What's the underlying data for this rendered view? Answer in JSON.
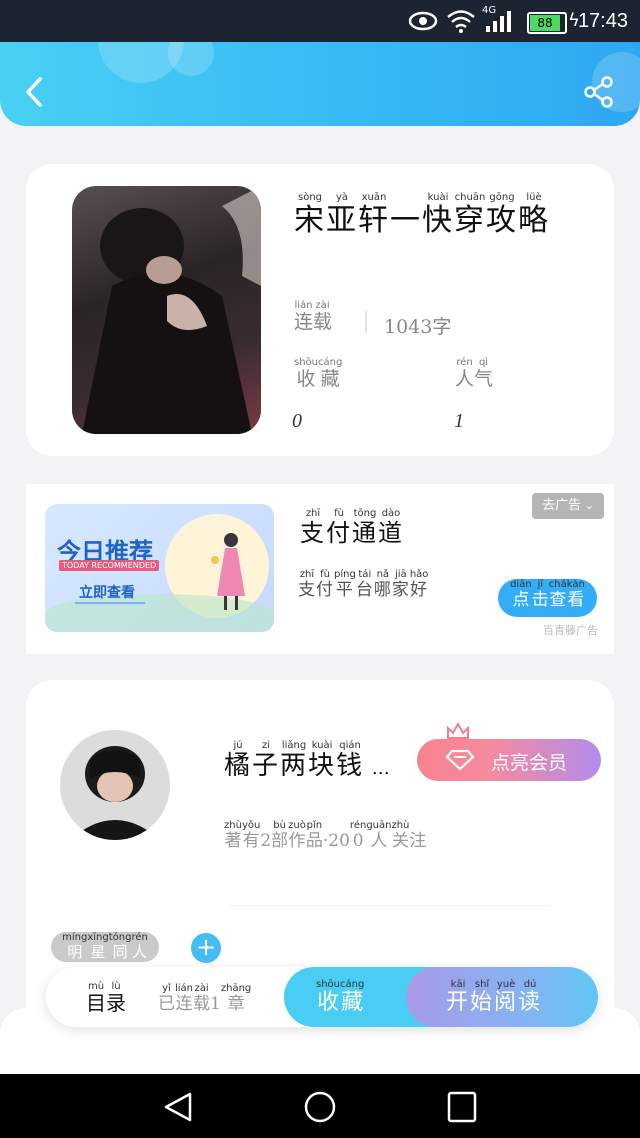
{
  "status_bar": {
    "time": "17:43",
    "network": "4G",
    "battery": "88"
  },
  "header": {
    "back_icon": "chevron-left-icon",
    "share_icon": "share-icon"
  },
  "book": {
    "title_chars": [
      {
        "c": "宋",
        "p": "sòng"
      },
      {
        "c": "亚",
        "p": "yà"
      },
      {
        "c": "轩",
        "p": "xuān"
      },
      {
        "c": "一",
        "p": ""
      },
      {
        "c": "快",
        "p": "kuài"
      },
      {
        "c": "穿",
        "p": "chuān"
      },
      {
        "c": "攻",
        "p": "gōng"
      },
      {
        "c": "略",
        "p": "lüè"
      }
    ],
    "status": {
      "text": "连载",
      "pinyin": [
        "lián",
        "zài"
      ]
    },
    "word_count": "1043字",
    "favorites_label": {
      "text": "收藏",
      "pinyin": [
        "shōu",
        "cáng"
      ]
    },
    "popularity_label": {
      "text": "人气",
      "pinyin": [
        "rén",
        "qì"
      ]
    },
    "favorites_count": "0",
    "popularity_count": "1"
  },
  "ad": {
    "banner_title": "今日推荐",
    "banner_subtitle": "TODAY RECOMMENDED",
    "banner_button": "立即查看",
    "tag": "去广告",
    "title": {
      "text": "支付通道",
      "pinyin": [
        "zhī",
        "fù",
        "tōng",
        "dào"
      ]
    },
    "desc": {
      "text": "支付平台哪家好",
      "pinyin": [
        "zhī",
        "fù",
        "píng",
        "tái",
        "nǎ",
        "jiā",
        "hǎo"
      ]
    },
    "button": {
      "text": "点击查看",
      "pinyin": [
        "diǎn",
        "jī",
        "chá",
        "kàn"
      ]
    },
    "footer": "百青藤广告"
  },
  "author": {
    "name": {
      "text": "橘子两块钱",
      "pinyin": [
        "jú",
        "zi",
        "liǎng",
        "kuài",
        "qián"
      ]
    },
    "stats": {
      "text": "著有2部作品·200人关注",
      "pinyin": [
        "zhù",
        "yǒu",
        "",
        "bù",
        "zuò",
        "pǐn",
        "",
        "",
        "",
        "rén",
        "guān",
        "zhù"
      ]
    },
    "vip_button": "点亮会员"
  },
  "tag_chip": {
    "text": "明星同人",
    "pinyin": [
      "míng",
      "xīng",
      "tóng",
      "rén"
    ]
  },
  "bottom_bar": {
    "catalog": {
      "text": "目录",
      "pinyin": [
        "mù",
        "lù"
      ]
    },
    "progress": {
      "text": "已连载1章",
      "pinyin": [
        "yǐ",
        "lián",
        "zài",
        "",
        "zhāng"
      ]
    },
    "favorite": {
      "text": "收藏",
      "pinyin": [
        "shōu",
        "cáng"
      ]
    },
    "read": {
      "text": "开始阅读",
      "pinyin": [
        "kāi",
        "shǐ",
        "yuè",
        "dú"
      ]
    }
  },
  "colors": {
    "accent": "#35b8f4",
    "vip_start": "#f88390",
    "vip_end": "#b18cec"
  }
}
